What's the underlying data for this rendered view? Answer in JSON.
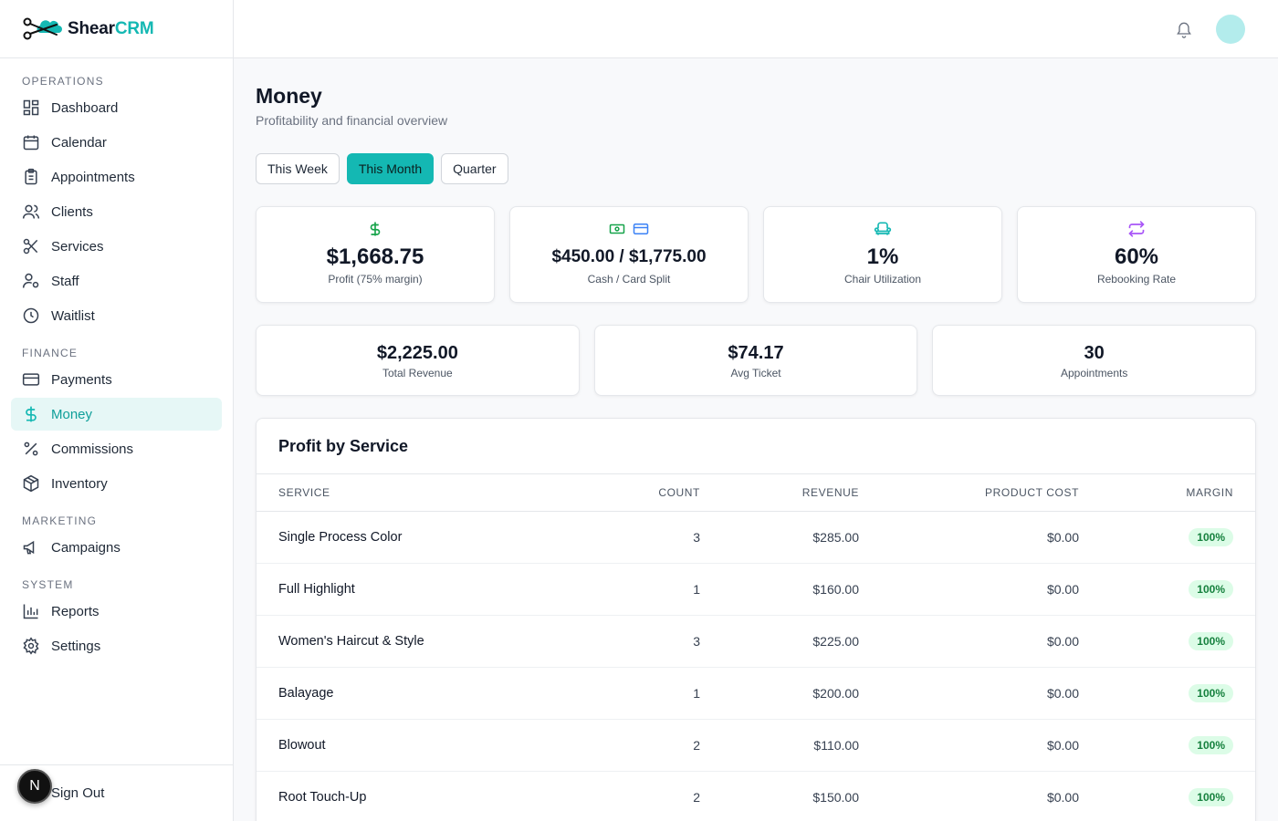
{
  "brand": {
    "name_prefix": "Shear",
    "name_suffix": "CRM"
  },
  "sidebar": {
    "sections": [
      {
        "title": "OPERATIONS",
        "items": [
          {
            "label": "Dashboard",
            "icon": "dashboard-icon"
          },
          {
            "label": "Calendar",
            "icon": "calendar-icon"
          },
          {
            "label": "Appointments",
            "icon": "clipboard-icon"
          },
          {
            "label": "Clients",
            "icon": "users-icon"
          },
          {
            "label": "Services",
            "icon": "scissors-icon"
          },
          {
            "label": "Staff",
            "icon": "user-cog-icon"
          },
          {
            "label": "Waitlist",
            "icon": "clock-icon"
          }
        ]
      },
      {
        "title": "FINANCE",
        "items": [
          {
            "label": "Payments",
            "icon": "credit-card-icon"
          },
          {
            "label": "Money",
            "icon": "dollar-icon",
            "active": true
          },
          {
            "label": "Commissions",
            "icon": "percent-icon"
          },
          {
            "label": "Inventory",
            "icon": "package-icon"
          }
        ]
      },
      {
        "title": "MARKETING",
        "items": [
          {
            "label": "Campaigns",
            "icon": "megaphone-icon"
          }
        ]
      },
      {
        "title": "SYSTEM",
        "items": [
          {
            "label": "Reports",
            "icon": "bar-chart-icon"
          },
          {
            "label": "Settings",
            "icon": "gear-icon"
          }
        ]
      }
    ],
    "footer": {
      "sign_out": "Sign Out",
      "fab_letter": "N"
    }
  },
  "page": {
    "title": "Money",
    "subtitle": "Profitability and financial overview",
    "periods": [
      "This Week",
      "This Month",
      "Quarter"
    ],
    "active_period": "This Month"
  },
  "stats": {
    "profit": {
      "value": "$1,668.75",
      "label": "Profit (75% margin)"
    },
    "split": {
      "value": "$450.00 / $1,775.00",
      "label": "Cash / Card Split"
    },
    "chair": {
      "value": "1%",
      "label": "Chair Utilization"
    },
    "rebook": {
      "value": "60%",
      "label": "Rebooking Rate"
    },
    "revenue": {
      "value": "$2,225.00",
      "label": "Total Revenue"
    },
    "ticket": {
      "value": "$74.17",
      "label": "Avg Ticket"
    },
    "appointments": {
      "value": "30",
      "label": "Appointments"
    }
  },
  "profit_table": {
    "title": "Profit by Service",
    "headers": {
      "service": "SERVICE",
      "count": "COUNT",
      "revenue": "REVENUE",
      "product_cost": "PRODUCT COST",
      "margin": "MARGIN"
    },
    "rows": [
      {
        "service": "Single Process Color",
        "count": "3",
        "revenue": "$285.00",
        "cost": "$0.00",
        "margin": "100%"
      },
      {
        "service": "Full Highlight",
        "count": "1",
        "revenue": "$160.00",
        "cost": "$0.00",
        "margin": "100%"
      },
      {
        "service": "Women's Haircut & Style",
        "count": "3",
        "revenue": "$225.00",
        "cost": "$0.00",
        "margin": "100%"
      },
      {
        "service": "Balayage",
        "count": "1",
        "revenue": "$200.00",
        "cost": "$0.00",
        "margin": "100%"
      },
      {
        "service": "Blowout",
        "count": "2",
        "revenue": "$110.00",
        "cost": "$0.00",
        "margin": "100%"
      },
      {
        "service": "Root Touch-Up",
        "count": "2",
        "revenue": "$150.00",
        "cost": "$0.00",
        "margin": "100%"
      }
    ]
  },
  "colors": {
    "accent": "#14b8b3",
    "money_green": "#16a34a",
    "card_blue": "#3b82f6",
    "purple": "#a855f7",
    "badge_bg": "#dcfce7"
  }
}
